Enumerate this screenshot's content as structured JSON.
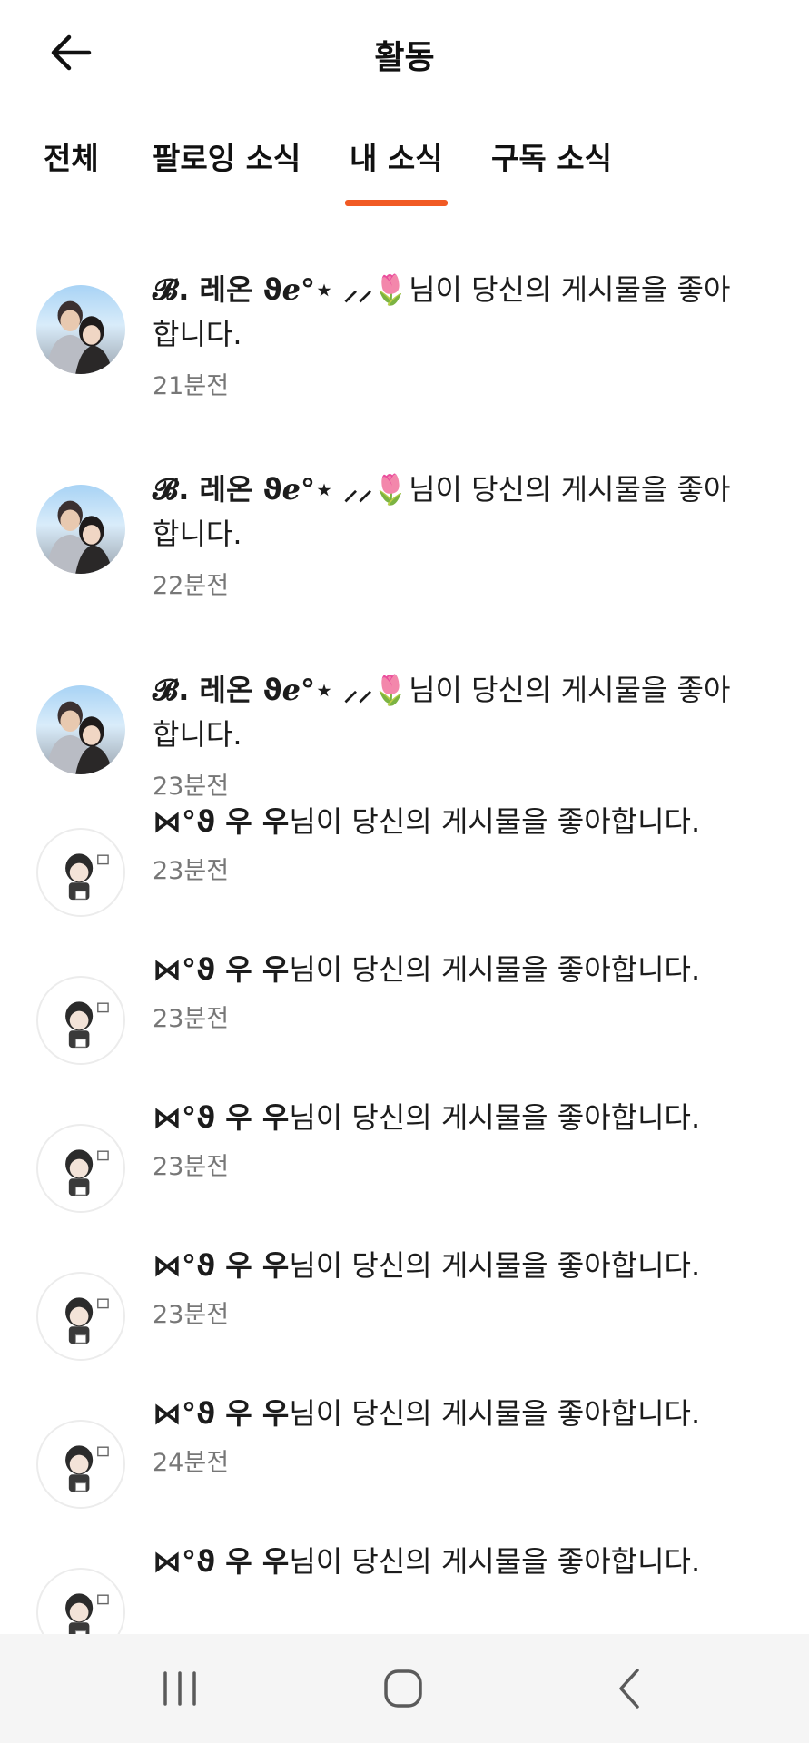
{
  "header": {
    "title": "활동",
    "back_icon": "arrow-left-icon"
  },
  "tabs": [
    {
      "label": "전체",
      "active": false
    },
    {
      "label": "팔로잉 소식",
      "active": false
    },
    {
      "label": "내 소식",
      "active": true
    },
    {
      "label": "구독 소식",
      "active": false
    }
  ],
  "accent_color": "#f15a24",
  "notifications": [
    {
      "user": "𝓑. 레온 ϑℯ°⋆ ⸝⸝🌷",
      "message": "님이 당신의 게시물을 좋아합니다.",
      "time": "21분전",
      "avatar": "couple-photo-avatar"
    },
    {
      "user": "𝓑. 레온 ϑℯ°⋆ ⸝⸝🌷",
      "message": "님이 당신의 게시물을 좋아합니다.",
      "time": "22분전",
      "avatar": "couple-photo-avatar"
    },
    {
      "user": "𝓑. 레온 ϑℯ°⋆ ⸝⸝🌷",
      "message": "님이 당신의 게시물을 좋아합니다.",
      "time": "23분전",
      "avatar": "couple-photo-avatar"
    },
    {
      "user": "⋈°ϑ 우 우",
      "message": "님이 당신의 게시물을 좋아합니다.",
      "time": "23분전",
      "avatar": "chibi-character-avatar"
    },
    {
      "user": "⋈°ϑ 우 우",
      "message": "님이 당신의 게시물을 좋아합니다.",
      "time": "23분전",
      "avatar": "chibi-character-avatar"
    },
    {
      "user": "⋈°ϑ 우 우",
      "message": "님이 당신의 게시물을 좋아합니다.",
      "time": "23분전",
      "avatar": "chibi-character-avatar"
    },
    {
      "user": "⋈°ϑ 우 우",
      "message": "님이 당신의 게시물을 좋아합니다.",
      "time": "23분전",
      "avatar": "chibi-character-avatar"
    },
    {
      "user": "⋈°ϑ 우 우",
      "message": "님이 당신의 게시물을 좋아합니다.",
      "time": "24분전",
      "avatar": "chibi-character-avatar"
    },
    {
      "user": "⋈°ϑ 우 우",
      "message": "님이 당신의 게시물을 좋아합니다.",
      "time": "",
      "avatar": "chibi-character-avatar"
    }
  ],
  "navbar": {
    "recents_icon": "recent-apps-icon",
    "home_icon": "home-icon",
    "back_icon": "back-chevron-icon"
  }
}
